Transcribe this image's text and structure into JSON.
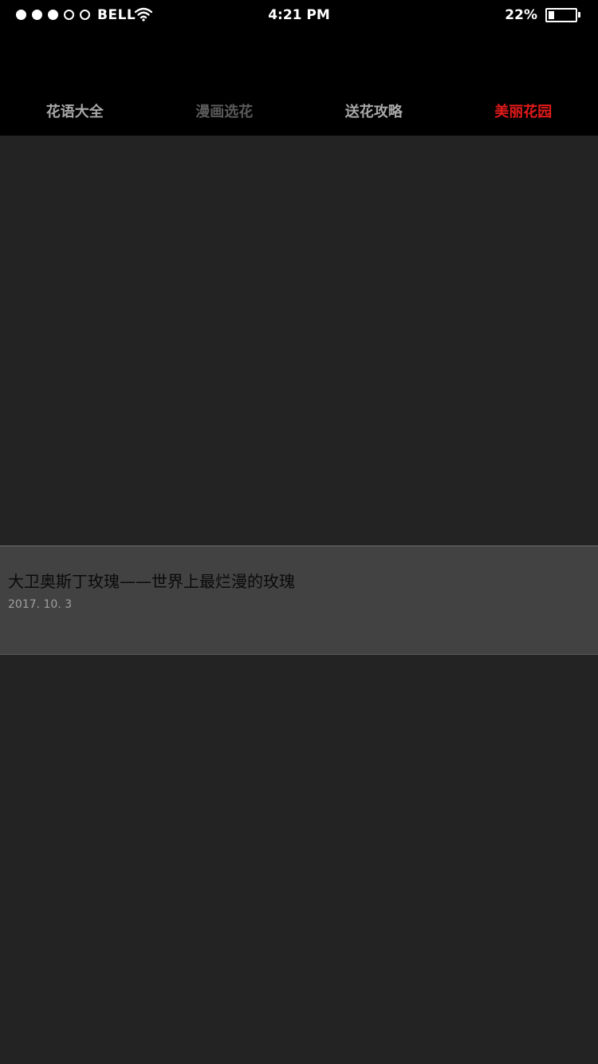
{
  "status_bar": {
    "carrier": "BELL",
    "time": "4:21 PM",
    "battery_percent": "22%",
    "battery_level": 0.22,
    "signal_strength": 3,
    "signal_max": 5
  },
  "tabs": [
    {
      "label": "花语大全",
      "state": "normal"
    },
    {
      "label": "漫画选花",
      "state": "dim"
    },
    {
      "label": "送花攻略",
      "state": "normal"
    },
    {
      "label": "美丽花园",
      "state": "active"
    }
  ],
  "article": {
    "title": "大卫奥斯丁玫瑰——世界上最烂漫的玫瑰",
    "date": "2017. 10. 3"
  },
  "colors": {
    "accent": "#e21a1a",
    "background": "#000000",
    "card": "#232323",
    "caption_bg": "#424242"
  }
}
